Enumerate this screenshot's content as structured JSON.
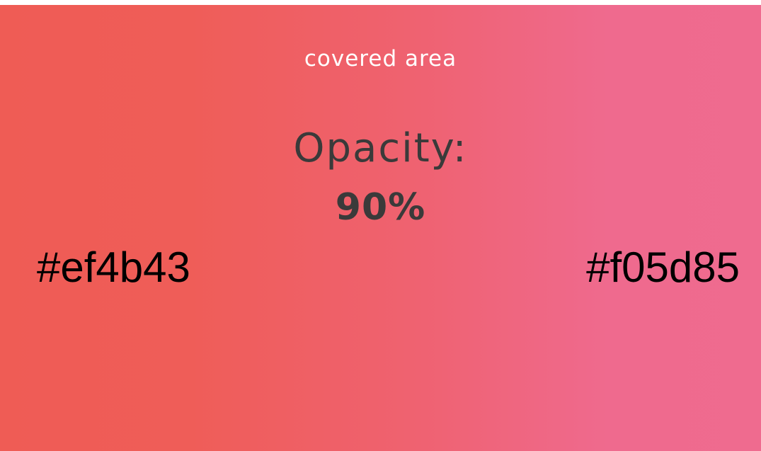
{
  "caption": "covered area",
  "opacity": {
    "label": "Opacity:",
    "value": "90%"
  },
  "colors": {
    "start": "#ef4b43",
    "end": "#f05d85"
  }
}
